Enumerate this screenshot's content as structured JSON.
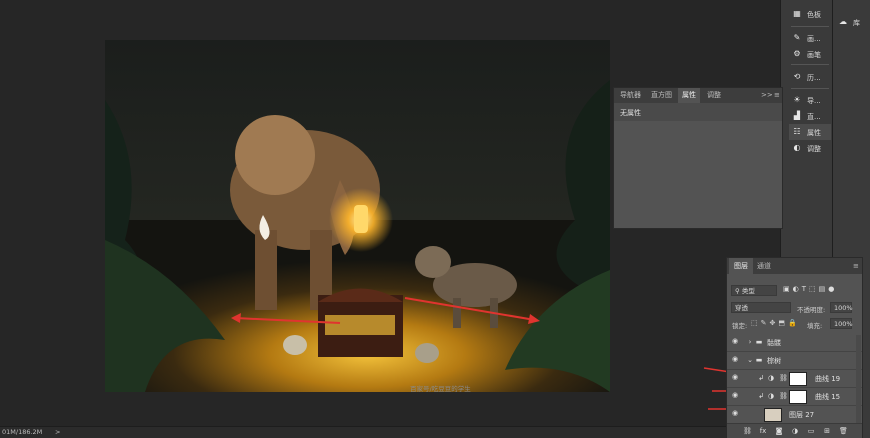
{
  "status_bar": {
    "doc_size": "01M/186.2M",
    "arrow": ">"
  },
  "right_panel": {
    "items": [
      {
        "icon": "swatches-icon",
        "glyph": "▦",
        "label": "色板"
      },
      {
        "icon": "brush-icon",
        "glyph": "✎",
        "label": "画..."
      },
      {
        "icon": "brush-settings-icon",
        "glyph": "⚙",
        "label": "画笔"
      },
      {
        "icon": "history-icon",
        "glyph": "⟲",
        "label": "历..."
      },
      {
        "icon": "sun-icon",
        "glyph": "☀",
        "label": "导..."
      },
      {
        "icon": "histogram-icon",
        "glyph": "▟",
        "label": "直..."
      },
      {
        "icon": "properties-icon",
        "glyph": "☷",
        "label": "属性"
      },
      {
        "icon": "adjustments-icon",
        "glyph": "◐",
        "label": "调整"
      }
    ],
    "library": {
      "icon": "library-icon",
      "glyph": "☁",
      "label": "库"
    }
  },
  "properties_panel": {
    "tabs": [
      "导航器",
      "直方图",
      "属性",
      "调整"
    ],
    "active_tab": 2,
    "collapse": ">>",
    "menu": "≡",
    "message": "无属性"
  },
  "layers_panel": {
    "tabs": [
      "图层",
      "通道"
    ],
    "active_tab": 0,
    "filter": "类型",
    "blend_mode": "穿透",
    "opacity_label": "不透明度:",
    "opacity": "100%",
    "lock_label": "锁定:",
    "fill_label": "填充:",
    "fill": "100%",
    "layers": [
      {
        "name": "骷髅",
        "kind": "group"
      },
      {
        "name": "棕树",
        "kind": "group"
      },
      {
        "name": "曲线 19",
        "kind": "adjustment"
      },
      {
        "name": "曲线 15",
        "kind": "adjustment"
      },
      {
        "name": "图层 27",
        "kind": "pixel"
      }
    ],
    "footer_icons": [
      "link-icon",
      "fx-icon",
      "mask-icon",
      "adjustment-icon",
      "folder-icon",
      "new-layer-icon",
      "trash-icon"
    ],
    "footer_glyphs": [
      "⛓",
      "fx",
      "◙",
      "◑",
      "▭",
      "⊞",
      "🗑"
    ]
  },
  "canvas": {
    "watermark": "百家号/吃豆豆的学生"
  },
  "colors": {
    "accent_red": "#e0342f",
    "lantern": "#ffb62b"
  }
}
